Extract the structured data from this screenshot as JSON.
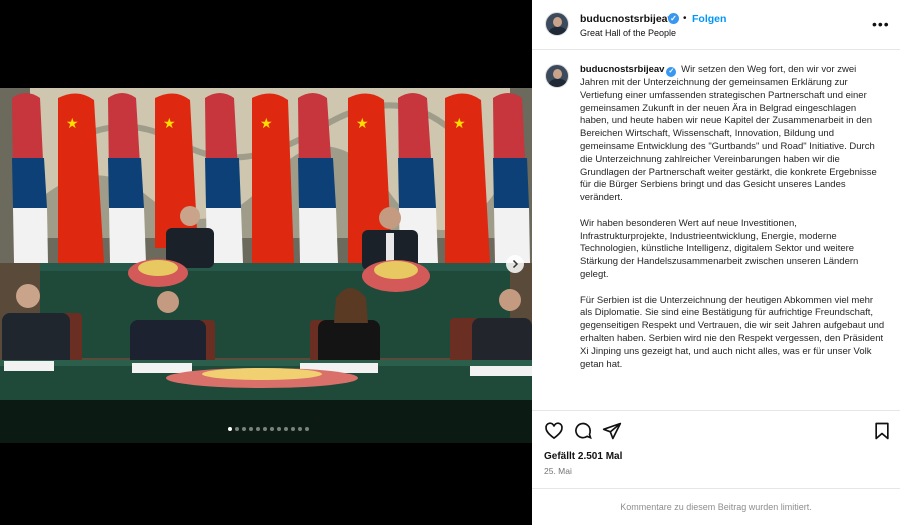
{
  "post": {
    "username": "buducnostsrbijeav",
    "separator": "•",
    "follow_label": "Folgen",
    "location": "Great Hall of the People",
    "more_icon": "more-horizontal-icon",
    "verified_icon": "verified-badge-icon"
  },
  "caption": {
    "username": "buducnostsrbijeav",
    "paragraphs": [
      "Wir setzen den Weg fort, den wir vor zwei Jahren mit der Unterzeichnung der gemeinsamen Erklärung zur Vertiefung einer umfassenden strategischen Partnerschaft und einer gemeinsamen Zukunft in der neuen Ära in Belgrad eingeschlagen haben, und heute haben wir neue Kapitel der Zusammenarbeit in den Bereichen Wirtschaft, Wissenschaft, Innovation, Bildung und gemeinsame Entwicklung des \"Gurtbands\" und Road\" Initiative. Durch die Unterzeichnung zahlreicher Vereinbarungen haben wir die Grundlagen der Partnerschaft weiter gestärkt, die konkrete Ergebnisse für die Bürger Serbiens bringt und das Gesicht unseres Landes verändert.",
      "Wir haben besonderen Wert auf neue Investitionen, Infrastrukturprojekte, Industrieentwicklung, Energie, moderne Technologien, künstliche Intelligenz, digitalem Sektor und weitere Stärkung der Handelszusammenarbeit zwischen unseren Ländern gelegt.",
      "Für Serbien ist die Unterzeichnung der heutigen Abkommen viel mehr als Diplomatie. Sie sind eine Bestätigung für aufrichtige Freundschaft, gegenseitigen Respekt und Vertrauen, die wir seit Jahren aufgebaut und erhalten haben. Serbien wird nie den Respekt vergessen, den Präsident Xi Jinping uns gezeigt hat, und auch nicht alles, was er für unser Volk getan hat."
    ]
  },
  "actions": {
    "like_icon": "heart-icon",
    "comment_icon": "comment-icon",
    "share_icon": "send-icon",
    "save_icon": "bookmark-icon"
  },
  "stats": {
    "likes": "Gefällt 2.501 Mal",
    "date": "25. Mai"
  },
  "footer": {
    "comments_limited": "Kommentare zu diesem Beitrag wurden limitiert."
  },
  "carousel": {
    "total_slides": 12,
    "current_slide": 1
  },
  "colors": {
    "follow": "#0095f6",
    "verified": "#3897f0",
    "china_red": "#de2910",
    "table_green": "#1f4a3a"
  }
}
